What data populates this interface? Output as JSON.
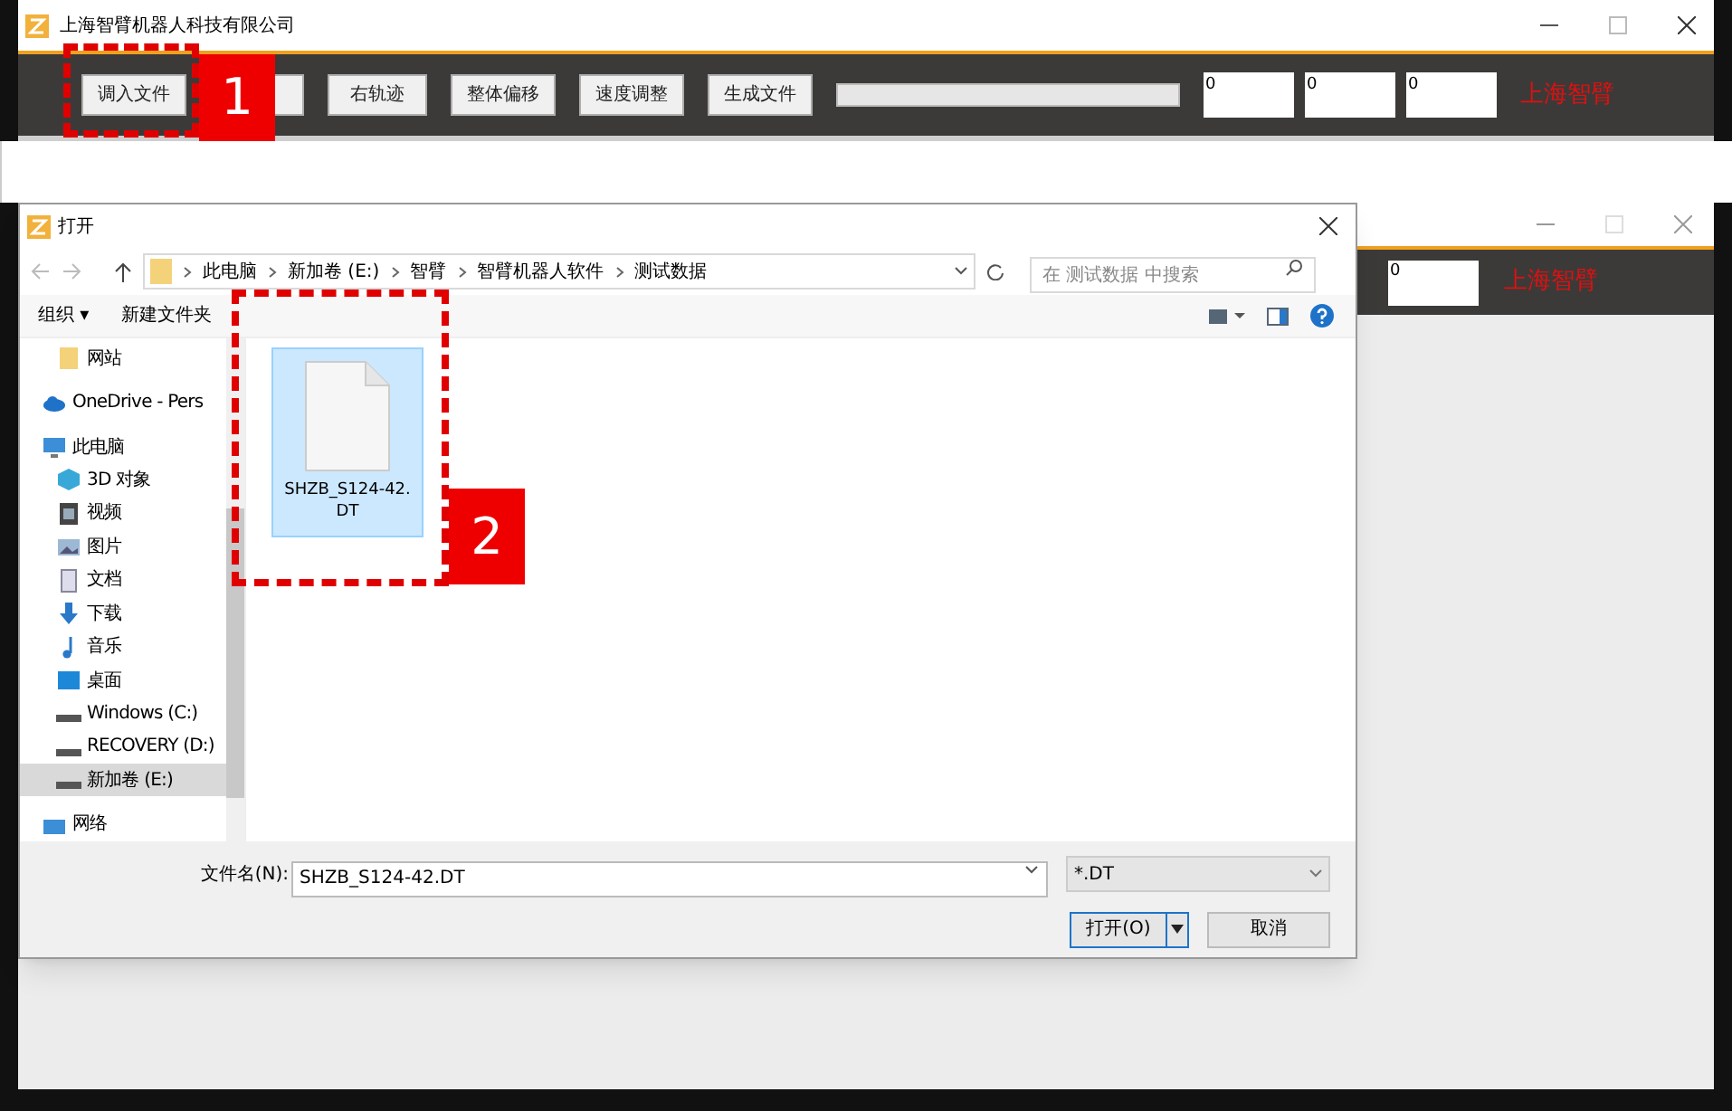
{
  "app": {
    "title": "上海智臂机器人科技有限公司",
    "toolbar": [
      {
        "label": "调入文件"
      },
      {
        "label": "右轨迹"
      },
      {
        "label": "整体偏移"
      },
      {
        "label": "速度调整"
      },
      {
        "label": "生成文件"
      }
    ],
    "fields": [
      "0",
      "0",
      "0"
    ],
    "brand": "上海智臂"
  },
  "background_app": {
    "fields": [
      "0"
    ],
    "brand": "上海智臂"
  },
  "dialog": {
    "title": "打开",
    "breadcrumb": [
      "此电脑",
      "新加卷 (E:)",
      "智臂",
      "智臂机器人软件",
      "测试数据"
    ],
    "search": {
      "placeholder": "在 测试数据 中搜索"
    },
    "toolbar": [
      "组织 ▾",
      "新建文件夹"
    ],
    "nav": [
      {
        "label": "网站",
        "kind": "folder",
        "selected": false
      },
      {
        "label": "OneDrive - Pers",
        "kind": "cloud",
        "selected": false
      },
      {
        "label": "此电脑",
        "kind": "pc",
        "selected": false,
        "children": [
          {
            "label": "3D 对象",
            "kind": "cube",
            "selected": false
          },
          {
            "label": "视频",
            "kind": "video",
            "selected": false
          },
          {
            "label": "图片",
            "kind": "image",
            "selected": false
          },
          {
            "label": "文档",
            "kind": "doc",
            "selected": false
          },
          {
            "label": "下载",
            "kind": "download",
            "selected": false
          },
          {
            "label": "音乐",
            "kind": "music",
            "selected": false
          },
          {
            "label": "桌面",
            "kind": "desktop",
            "selected": false
          },
          {
            "label": "Windows (C:)",
            "kind": "drive",
            "selected": false
          },
          {
            "label": "RECOVERY (D:)",
            "kind": "drive",
            "selected": false
          },
          {
            "label": "新加卷 (E:)",
            "kind": "drive",
            "selected": true
          }
        ]
      },
      {
        "label": "网络",
        "kind": "network",
        "selected": false
      }
    ],
    "files": [
      {
        "name": "SHZB_S124-42.DT",
        "selected": true
      }
    ],
    "filename_label": "文件名(N):",
    "filename": "SHZB_S124-42.DT",
    "filter": "*.DT",
    "buttons": [
      "打开(O)",
      "取消"
    ]
  },
  "annotations": [
    "1",
    "2"
  ]
}
